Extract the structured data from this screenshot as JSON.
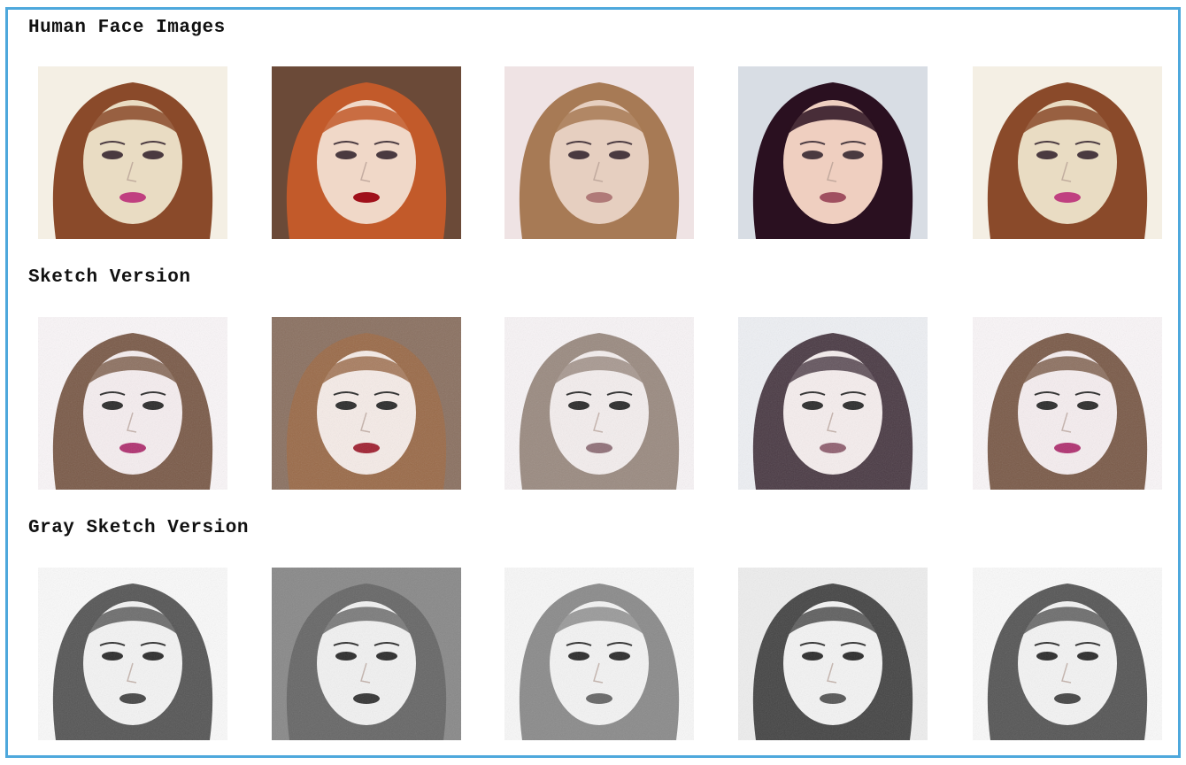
{
  "sections": [
    {
      "title": "Human Face Images",
      "style": "color",
      "images": [
        {
          "name": "face-1",
          "hair": "#8a4a2a",
          "skin": "#e9dcc3",
          "lips": "#c04080",
          "bg": "#f4efe4"
        },
        {
          "name": "face-2",
          "hair": "#c25a2a",
          "skin": "#f0d8c8",
          "lips": "#a0101a",
          "bg": "#6b4a38"
        },
        {
          "name": "face-3",
          "hair": "#a77a55",
          "skin": "#e6cfc0",
          "lips": "#b07a78",
          "bg": "#efe3e4"
        },
        {
          "name": "face-4",
          "hair": "#2a1020",
          "skin": "#efcfc0",
          "lips": "#a05060",
          "bg": "#d8dde4"
        },
        {
          "name": "face-5",
          "hair": "#8a4a2a",
          "skin": "#e9dcc3",
          "lips": "#c04080",
          "bg": "#f4efe4"
        }
      ]
    },
    {
      "title": "Sketch Version",
      "style": "sketch",
      "images": [
        {
          "name": "sketch-1",
          "hair": "#7a5a48",
          "skin": "#f6eef0",
          "lips": "#b03070",
          "bg": "#faf6f8"
        },
        {
          "name": "sketch-2",
          "hair": "#9a6a48",
          "skin": "#f6ece8",
          "lips": "#a02030",
          "bg": "#8a7060"
        },
        {
          "name": "sketch-3",
          "hair": "#9a8a80",
          "skin": "#f4eeee",
          "lips": "#907078",
          "bg": "#f8f4f6"
        },
        {
          "name": "sketch-4",
          "hair": "#4a3a44",
          "skin": "#f6eeee",
          "lips": "#906070",
          "bg": "#eef0f4"
        },
        {
          "name": "sketch-5",
          "hair": "#7a5a48",
          "skin": "#f6eef0",
          "lips": "#b03070",
          "bg": "#faf6f8"
        }
      ]
    },
    {
      "title": "Gray Sketch Version",
      "style": "gray",
      "images": [
        {
          "name": "gray-1",
          "hair": "#555555",
          "skin": "#f4f4f4",
          "lips": "#444444",
          "bg": "#fafafa"
        },
        {
          "name": "gray-2",
          "hair": "#666666",
          "skin": "#f2f2f2",
          "lips": "#333333",
          "bg": "#888888"
        },
        {
          "name": "gray-3",
          "hair": "#8a8a8a",
          "skin": "#f4f4f4",
          "lips": "#666666",
          "bg": "#f8f8f8"
        },
        {
          "name": "gray-4",
          "hair": "#444444",
          "skin": "#f4f4f4",
          "lips": "#555555",
          "bg": "#eeeeee"
        },
        {
          "name": "gray-5",
          "hair": "#555555",
          "skin": "#f4f4f4",
          "lips": "#444444",
          "bg": "#fafafa"
        }
      ]
    }
  ],
  "colors": {
    "frame_border": "#4ea8dc",
    "title_text": "#111111"
  }
}
